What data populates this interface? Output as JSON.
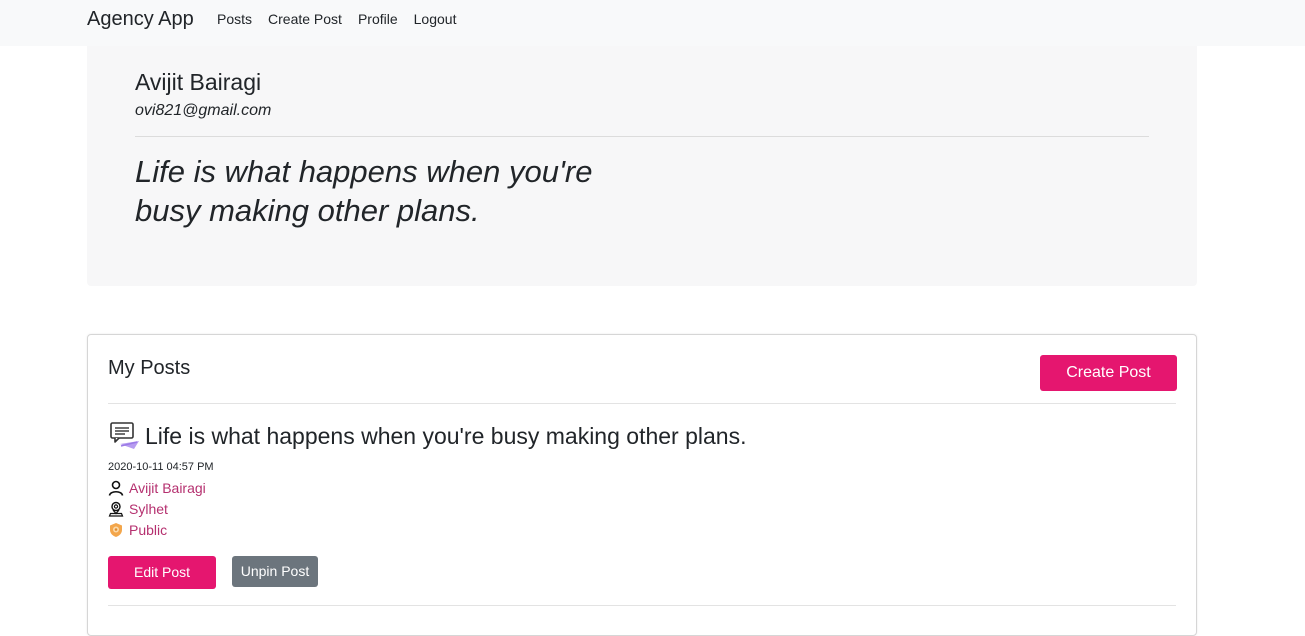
{
  "navbar": {
    "brand": "Agency App",
    "links": [
      "Posts",
      "Create Post",
      "Profile",
      "Logout"
    ]
  },
  "profile": {
    "name": "Avijit Bairagi",
    "email": "ovi821@gmail.com",
    "quote": "Life is what happens when you're busy making other plans."
  },
  "posts_section": {
    "title": "My Posts",
    "create_button": "Create Post",
    "post": {
      "icon": "chat-message-icon",
      "title": "Life is what happens when you're busy making other plans.",
      "date": "2020-10-11 04:57 PM",
      "author": "Avijit Bairagi",
      "location": "Sylhet",
      "privacy": "Public",
      "edit_button": "Edit Post",
      "unpin_button": "Unpin Post"
    }
  },
  "colors": {
    "accent": "#e5166f",
    "secondary_button": "#6c757d",
    "meta_link": "#b5306f",
    "navbar_bg": "#f8f9fa",
    "jumbotron_bg": "#f7f7f8"
  }
}
